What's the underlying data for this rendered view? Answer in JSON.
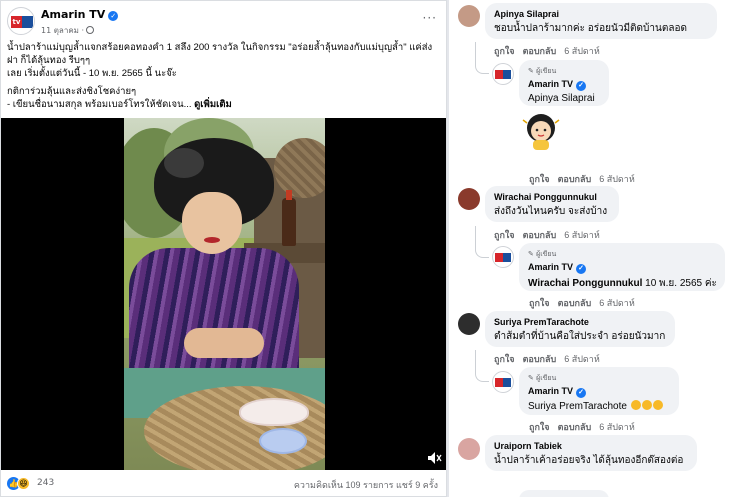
{
  "post": {
    "page_name": "Amarin TV",
    "date": "11 ตุลาคม",
    "logo_text": "tv",
    "text_lines": [
      "น้ำปลาร้าแม่บุญล้ำแจกสร้อยคอทองคำ 1 สลึง 200 รางวัล ในกิจกรรม \"อร่อยล้ำลุ้นทองกับแม่บุญล้ำ\" แค่ส่ง",
      "ฝา ก็ได้ลุ้นทอง รีบๆๆ",
      "เลย เริ่มตั้งแต่วันนี้ - 10 พ.ย. 2565 นี้ นะจ๊ะ"
    ],
    "text_lines_2": [
      "กติการ่วมลุ้นและส่งชิงโชคง่ายๆ",
      "- เขียนชื่อนามสกุล พร้อมเบอร์โทรให้ชัดเจน..."
    ],
    "see_more": "ดูเพิ่มเติม",
    "reaction_count": "243",
    "stats": "ความคิดเห็น 109 รายการ  แชร์ 9 ครั้ง"
  },
  "comments": {
    "like": "ถูกใจ",
    "reply": "ตอบกลับ",
    "author_badge": "ผู้เขียน",
    "items": [
      {
        "name": "Apinya Silaprai",
        "text": "ชอบน้ำปลาร้ามากค่ะ อร่อยนัวมีติดบ้านตลอด",
        "time": "6 สัปดาห์"
      },
      {
        "name": "Amarin TV",
        "text": "Apinya Silaprai",
        "time": "6 สัปดาห์"
      },
      {
        "name": "Wirachai Ponggunnukul",
        "text": "ส่งถึงวันไหนครับ จะส่งบ้าง",
        "time": "6 สัปดาห์"
      },
      {
        "name": "Amarin TV",
        "text_tag": "Wirachai Ponggunnukul",
        "text_rest": " 10 พ.ย. 2565 ค่ะ",
        "time": "6 สัปดาห์"
      },
      {
        "name": "Suriya PremTarachote",
        "text": "ตำส้มตำที่บ้านคือใส่ประจำ อร่อยนัวมาก",
        "time": "6 สัปดาห์"
      },
      {
        "name": "Amarin TV",
        "text": "Suriya PremTarachote",
        "time": "6 สัปดาห์"
      },
      {
        "name": "Uraiporn Tabiek",
        "text": "น้ำปลาร้าเค้าอร่อยจริง ได้ลุ้นทองอีกต๊สองต่อ"
      }
    ]
  }
}
